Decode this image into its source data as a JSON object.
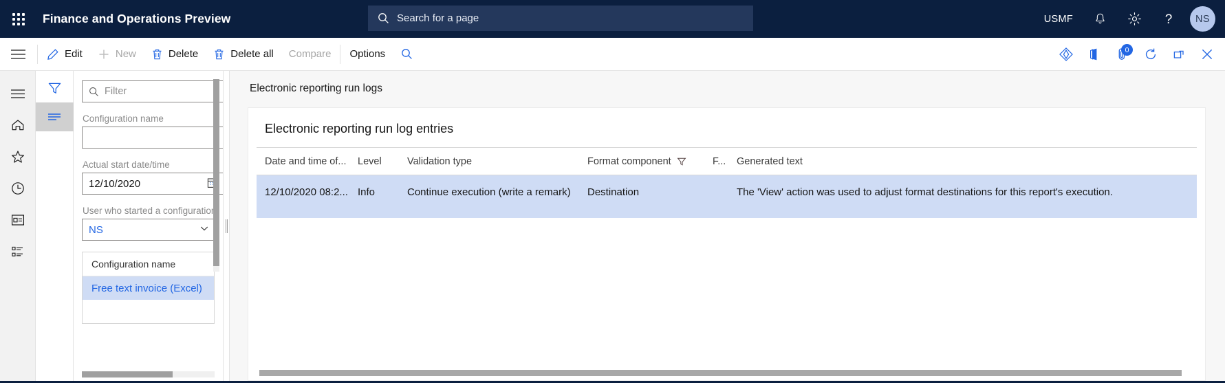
{
  "navbar": {
    "waffle_icon": "waffle-grid-icon",
    "app_title": "Finance and Operations Preview",
    "search": {
      "icon": "search-icon",
      "placeholder": "Search for a page",
      "value": ""
    },
    "company": "USMF",
    "notifications_icon": "bell-icon",
    "settings_icon": "gear-icon",
    "help_icon": "question-mark-icon",
    "avatar_initials": "NS",
    "background_color": "#0b1f3f",
    "search_background": "#24385c",
    "avatar_color": "#b6c8ec"
  },
  "action_pane": {
    "hamburger_icon": "hamburger-menu-icon",
    "buttons": [
      {
        "label": "Edit",
        "icon": "pencil-icon",
        "disabled": false
      },
      {
        "label": "New",
        "icon": "plus-icon",
        "disabled": true
      },
      {
        "label": "Delete",
        "icon": "trash-icon",
        "disabled": false
      },
      {
        "label": "Delete all",
        "icon": "trash-icon",
        "disabled": false
      },
      {
        "label": "Compare",
        "icon": "",
        "disabled": true
      }
    ],
    "options_label": "Options",
    "search_icon": "search-icon",
    "right_icons": [
      {
        "name": "teams-share-icon",
        "badge": ""
      },
      {
        "name": "office-app-icon",
        "badge": ""
      },
      {
        "name": "attachments-icon",
        "badge": "0"
      },
      {
        "name": "refresh-icon",
        "badge": ""
      },
      {
        "name": "popout-icon",
        "badge": ""
      },
      {
        "name": "close-icon",
        "badge": ""
      }
    ],
    "accent_color": "#2266e3"
  },
  "rail": {
    "items": [
      {
        "name": "hamburger-menu-icon",
        "label": "Navigation"
      },
      {
        "name": "home-icon",
        "label": "Home"
      },
      {
        "name": "star-icon",
        "label": "Favorites"
      },
      {
        "name": "clock-icon",
        "label": "Recent"
      },
      {
        "name": "workspaces-icon",
        "label": "Workspaces"
      },
      {
        "name": "modules-icon",
        "label": "Modules"
      }
    ]
  },
  "filter_tabs": [
    {
      "name": "filter-funnel-icon",
      "label": "Filters",
      "active": false
    },
    {
      "name": "filter-lines-icon",
      "label": "Filter pane",
      "active": true
    }
  ],
  "filter_pane": {
    "search": {
      "icon": "search-icon",
      "placeholder": "Filter",
      "value": ""
    },
    "fields": [
      {
        "label": "Configuration name",
        "value": "",
        "type": "text"
      },
      {
        "label": "Actual start date/time",
        "value": "12/10/2020",
        "type": "date",
        "icon": "calendar-icon"
      },
      {
        "label": "User who started a configuration",
        "value": "NS",
        "type": "combo",
        "icon": "chevron-down-icon"
      }
    ],
    "grid": {
      "header": "Configuration name",
      "rows": [
        "Free text invoice (Excel)"
      ],
      "selected_index": 0
    },
    "selection_color": "#cfdcf5",
    "link_color": "#2266e3"
  },
  "main": {
    "page_caption": "Electronic reporting run logs",
    "card_title": "Electronic reporting run log entries",
    "grid": {
      "columns": [
        {
          "key": "date",
          "label": "Date and time of...",
          "sort_icon": "sort-desc-arrow-icon",
          "sorted": true
        },
        {
          "key": "level",
          "label": "Level",
          "sorted": false
        },
        {
          "key": "validation_type",
          "label": "Validation type",
          "sorted": false
        },
        {
          "key": "format_component",
          "label": "Format component",
          "filter_icon": "filter-funnel-icon",
          "filtered": true
        },
        {
          "key": "f",
          "label": "F...",
          "sorted": false
        },
        {
          "key": "generated_text",
          "label": "Generated text",
          "sorted": false
        }
      ],
      "rows": [
        {
          "date": "12/10/2020 08:2...",
          "level": "Info",
          "validation_type": "Continue execution (write a remark)",
          "format_component": "Destination",
          "f": "",
          "generated_text": "The 'View' action was used to adjust format destinations for this report's execution.",
          "selected": true
        }
      ],
      "selection_color": "#cfdcf5"
    }
  }
}
